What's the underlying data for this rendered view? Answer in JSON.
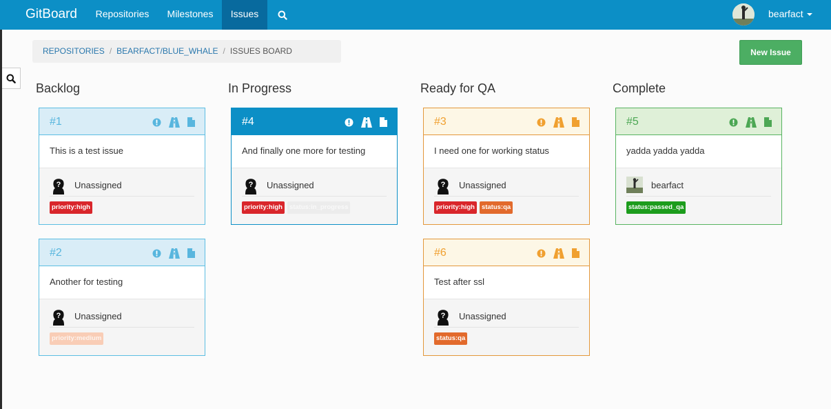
{
  "navbar": {
    "brand": "GitBoard",
    "items": [
      "Repositories",
      "Milestones",
      "Issues"
    ],
    "user": "bearfact"
  },
  "breadcrumb": [
    "REPOSITORIES",
    "BEARFACT/BLUE_WHALE",
    "ISSUES BOARD"
  ],
  "new_issue_label": "New Issue",
  "colors": {
    "navbar": "#0c8fc6",
    "active_nav": "#086a9e",
    "backlog": "#5bbde2",
    "in_progress": "#0c8fc6",
    "ready_for_qa": "#e3973a",
    "complete": "#57b360",
    "label_priority_high": "#d9262b",
    "label_status_qa": "#e26a2c",
    "label_priority_medium": "#f9cdb6",
    "label_status_in_progress": "#ececec",
    "label_status_passed_qa": "#1c9c1c"
  },
  "columns": [
    {
      "title": "Backlog",
      "cards": [
        {
          "number": "#1",
          "title": "This is a test issue",
          "assignee": "Unassigned",
          "labels": [
            "priority:high"
          ]
        },
        {
          "number": "#2",
          "title": "Another for testing",
          "assignee": "Unassigned",
          "labels": [
            "priority:medium"
          ]
        }
      ]
    },
    {
      "title": "In Progress",
      "cards": [
        {
          "number": "#4",
          "title": "And finally one more for testing",
          "assignee": "Unassigned",
          "labels": [
            "priority:high",
            "status:in_progress"
          ]
        }
      ]
    },
    {
      "title": "Ready for QA",
      "cards": [
        {
          "number": "#3",
          "title": "I need one for working status",
          "assignee": "Unassigned",
          "labels": [
            "priority:high",
            "status:qa"
          ]
        },
        {
          "number": "#6",
          "title": "Test after ssl",
          "assignee": "Unassigned",
          "labels": [
            "status:qa"
          ]
        }
      ]
    },
    {
      "title": "Complete",
      "cards": [
        {
          "number": "#5",
          "title": "yadda yadda yadda",
          "assignee": "bearfact",
          "labels": [
            "status:passed_qa"
          ]
        }
      ]
    }
  ],
  "icons": [
    "search-icon",
    "exclamation-circle-icon",
    "road-icon",
    "file-icon",
    "unassigned-avatar-icon",
    "user-avatar"
  ]
}
